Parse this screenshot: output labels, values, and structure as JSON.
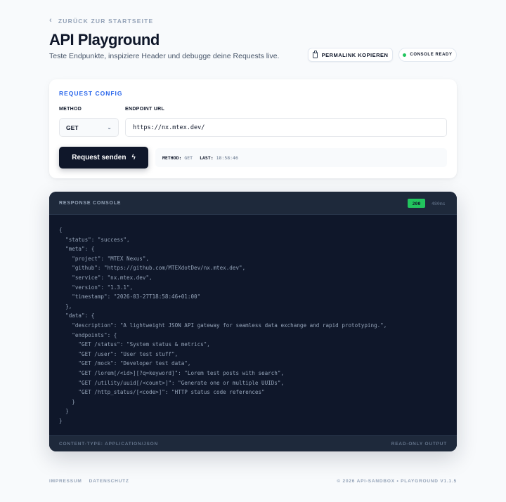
{
  "nav": {
    "back_label": "ZURÜCK ZUR STARTSEITE"
  },
  "header": {
    "title": "API Playground",
    "subtitle": "Teste Endpunkte, inspiziere Header und debugge deine Requests live.",
    "permalink_label": "PERMALINK KOPIEREN",
    "status_badge": "CONSOLE READY"
  },
  "request": {
    "section_title": "REQUEST CONFIG",
    "method_label": "METHOD",
    "method_value": "GET",
    "url_label": "ENDPOINT URL",
    "url_value": "https://nx.mtex.dev/",
    "send_label": "Request senden",
    "info_method_label": "METHOD:",
    "info_method_value": "GET",
    "info_last_label": "LAST:",
    "info_last_value": "18:58:46"
  },
  "console": {
    "title": "RESPONSE CONSOLE",
    "status_code": "200",
    "timing": "480ms",
    "body": "{\n  \"status\": \"success\",\n  \"meta\": {\n    \"project\": \"MTEX Nexus\",\n    \"github\": \"https://github.com/MTEXdotDev/nx.mtex.dev\",\n    \"service\": \"nx.mtex.dev\",\n    \"version\": \"1.3.1\",\n    \"timestamp\": \"2026-03-27T18:58:46+01:00\"\n  },\n  \"data\": {\n    \"description\": \"A lightweight JSON API gateway for seamless data exchange and rapid prototyping.\",\n    \"endpoints\": {\n      \"GET /status\": \"System status & metrics\",\n      \"GET /user\": \"User test stuff\",\n      \"GET /mock\": \"Developer test data\",\n      \"GET /lorem[/<id>][?q=keyword]\": \"Lorem test posts with search\",\n      \"GET /utility/uuid[/<count>]\": \"Generate one or multiple UUIDs\",\n      \"GET /http_status/[<code>]\": \"HTTP status code references\"\n    }\n  }\n}",
    "footer_left": "CONTENT-TYPE: APPLICATION/JSON",
    "footer_right": "READ-ONLY OUTPUT"
  },
  "footer": {
    "impressum": "IMPRESSUM",
    "datenschutz": "DATENSCHUTZ",
    "copyright": "© 2026 API-SANDBOX • PLAYGROUND V1.1.5"
  },
  "colors": {
    "accent": "#2563eb",
    "success": "#22c55e",
    "console_bg": "#0f172a",
    "primary_button": "#0f172a"
  }
}
